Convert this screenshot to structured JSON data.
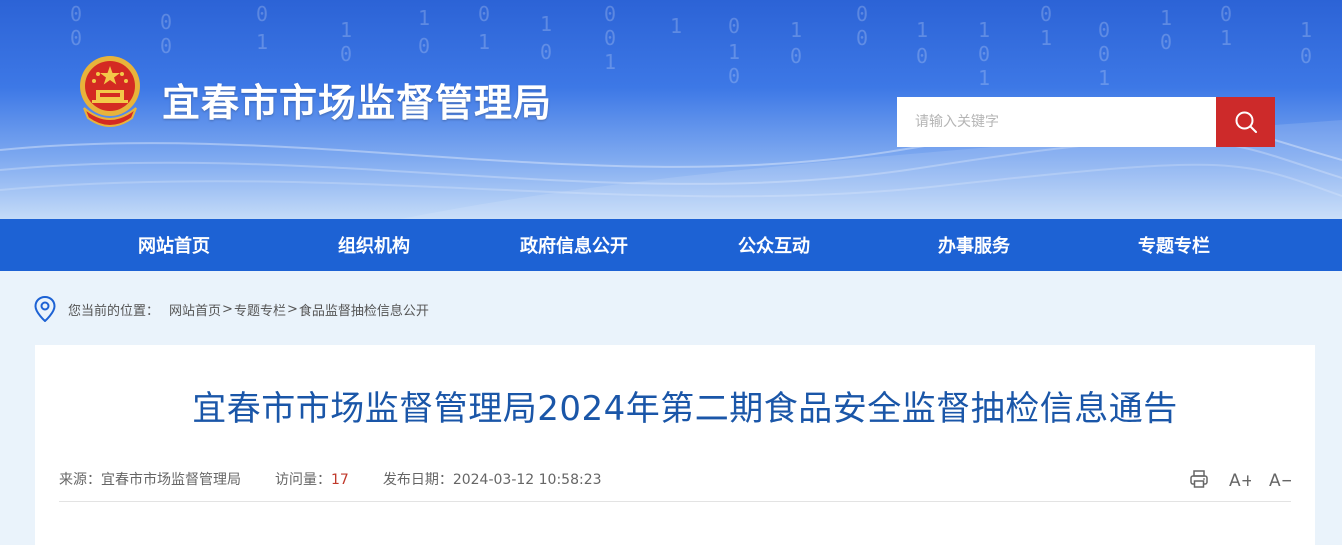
{
  "header": {
    "site_title": "宜春市市场监督管理局",
    "search_placeholder": "请输入关键字"
  },
  "nav": {
    "items": [
      "网站首页",
      "组织机构",
      "政府信息公开",
      "公众互动",
      "办事服务",
      "专题专栏"
    ]
  },
  "breadcrumb": {
    "label": "您当前的位置：",
    "items": [
      "网站首页",
      "专题专栏",
      "食品监督抽检信息公开"
    ],
    "separator": ">"
  },
  "article": {
    "title": "宜春市市场监督管理局2024年第二期食品安全监督抽检信息通告",
    "source_label": "来源：",
    "source_value": "宜春市市场监督管理局",
    "views_label": "访问量：",
    "views_value": "17",
    "date_label": "发布日期：",
    "date_value": "2024-03-12 10:58:23"
  },
  "tools": {
    "print_icon": "printer-icon",
    "font_increase_label": "A+",
    "font_decrease_label": "A−"
  },
  "colors": {
    "nav_bg": "#1d62d4",
    "search_button": "#cd2a2a",
    "title_color": "#1a56a8",
    "views_color": "#c0392b"
  }
}
